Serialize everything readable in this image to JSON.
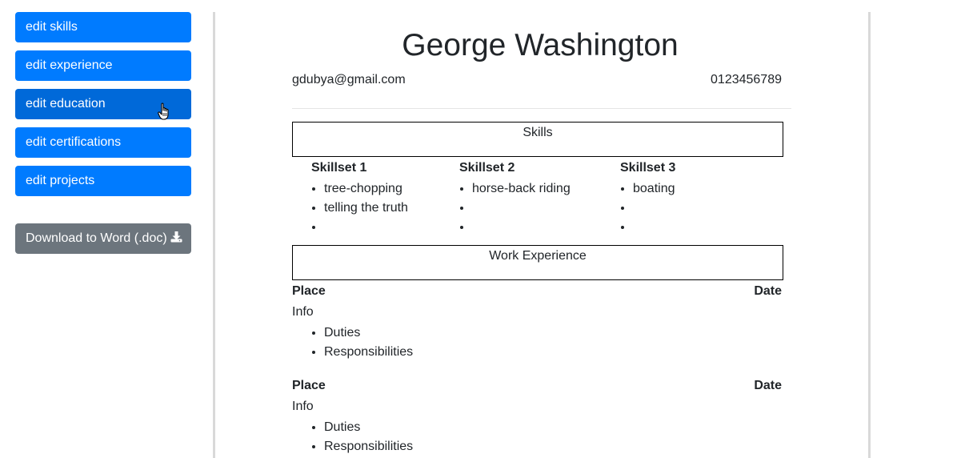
{
  "sidebar": {
    "buttons": [
      {
        "label": "edit skills"
      },
      {
        "label": "edit experience"
      },
      {
        "label": "edit education"
      },
      {
        "label": "edit certifications"
      },
      {
        "label": "edit projects"
      }
    ],
    "download_label": "Download to Word (.doc)"
  },
  "resume": {
    "name": "George Washington",
    "email": "gdubya@gmail.com",
    "phone": "0123456789",
    "skills_heading": "Skills",
    "skillsets": [
      {
        "title": "Skillset 1",
        "items": [
          "tree-chopping",
          "telling the truth",
          ""
        ]
      },
      {
        "title": "Skillset 2",
        "items": [
          "horse-back riding",
          "",
          ""
        ]
      },
      {
        "title": "Skillset 3",
        "items": [
          "boating",
          "",
          ""
        ]
      }
    ],
    "experience_heading": "Work Experience",
    "jobs": [
      {
        "place": "Place",
        "date": "Date",
        "info": "Info",
        "items": [
          "Duties",
          "Responsibilities"
        ]
      },
      {
        "place": "Place",
        "date": "Date",
        "info": "Info",
        "items": [
          "Duties",
          "Responsibilities"
        ]
      }
    ]
  },
  "colors": {
    "primary_button": "#007bff",
    "active_button": "#0069d9",
    "secondary_button": "#6c757d"
  },
  "icons": [
    "download-icon",
    "hand-pointer-icon"
  ]
}
